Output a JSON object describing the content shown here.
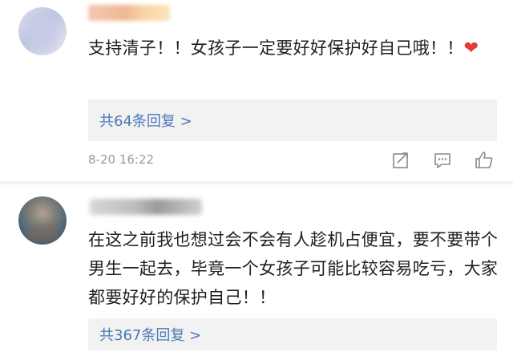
{
  "comments": [
    {
      "text": "支持清子！！女孩子一定要好好保护好自己哦！！",
      "emoji": "❤",
      "emoji_name": "heart-emoji",
      "replies_label": "共64条回复 >",
      "timestamp": "8-20 16:22",
      "actions": [
        "share-icon",
        "comment-icon",
        "like-icon"
      ]
    },
    {
      "text": "在这之前我也想过会不会有人趁机占便宜，要不要带个男生一起去，毕竟一个女孩子可能比较容易吃亏，大家都要好好的保护自己！！",
      "replies_label": "共367条回复 >"
    }
  ],
  "colors": {
    "link": "#4a78b5",
    "meta": "#9a9a9a",
    "reply_bg": "#f2f2f2",
    "heart": "#e53935"
  }
}
